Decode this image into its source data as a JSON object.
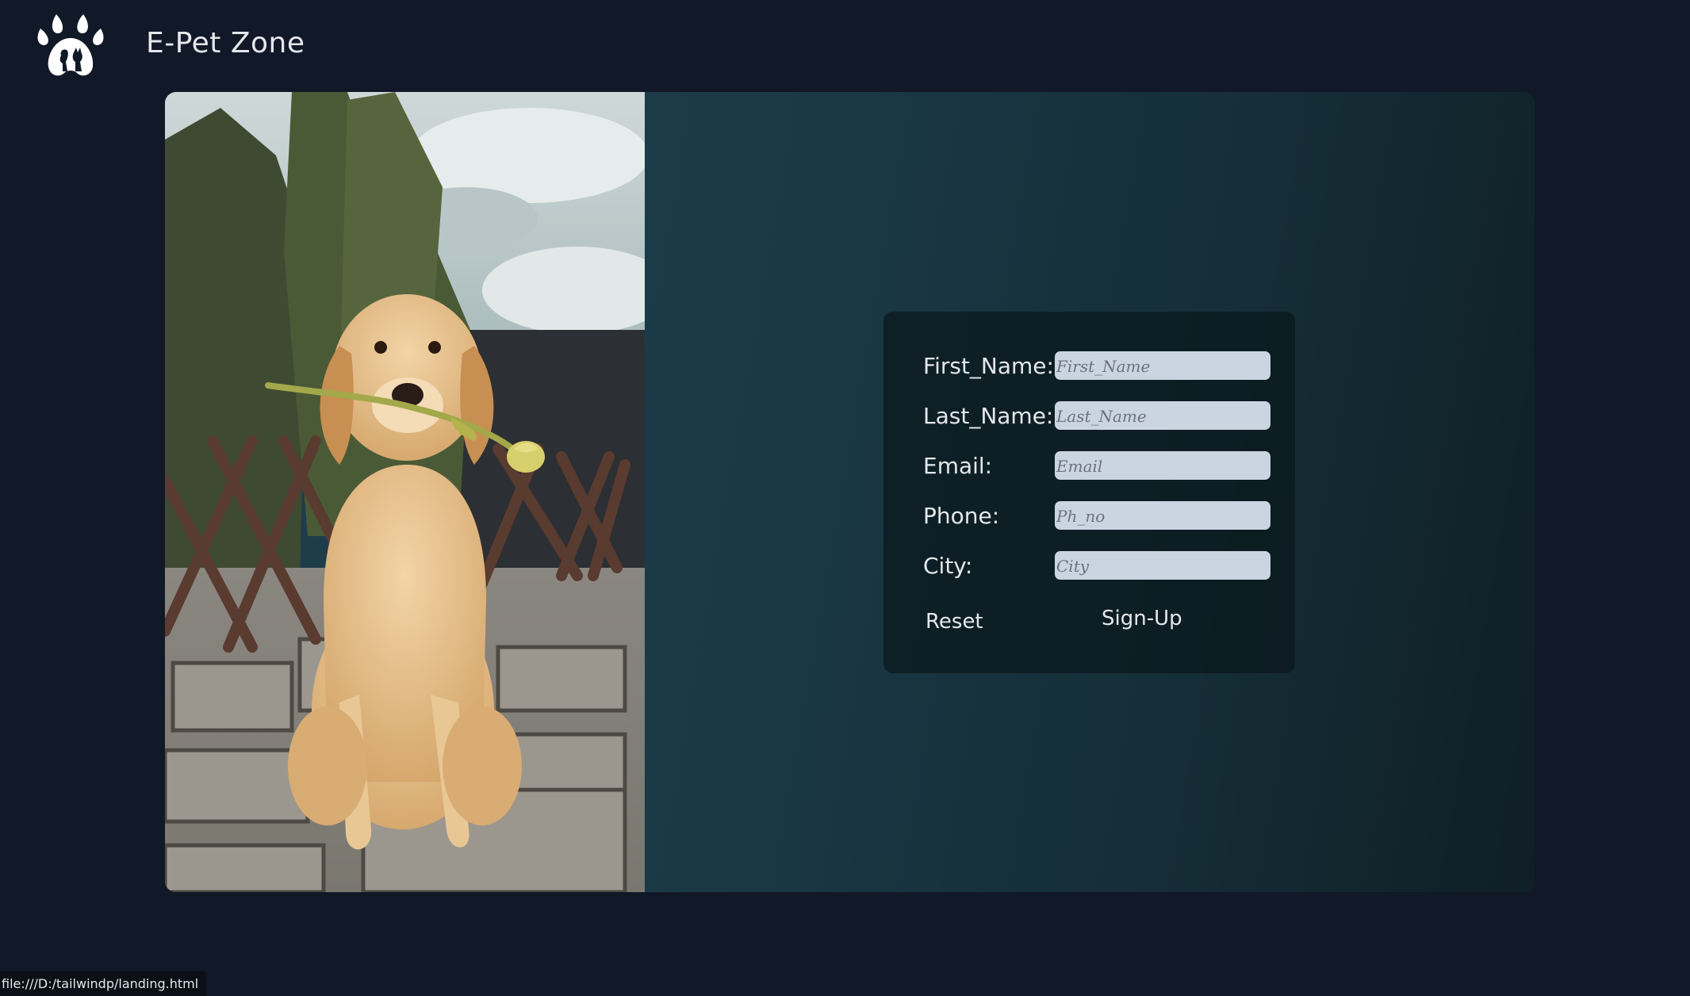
{
  "header": {
    "brand": "E-Pet Zone",
    "logo_icon": "paw-pet-logo-icon"
  },
  "hero": {
    "image": "golden-retriever-puppy-with-tulip-photo"
  },
  "form": {
    "fields": [
      {
        "label": "First_Name:",
        "placeholder": "First_Name",
        "value": ""
      },
      {
        "label": "Last_Name:",
        "placeholder": "Last_Name",
        "value": ""
      },
      {
        "label": "Email:",
        "placeholder": "Email",
        "value": ""
      },
      {
        "label": "Phone:",
        "placeholder": "Ph_no",
        "value": ""
      },
      {
        "label": "City:",
        "placeholder": "City",
        "value": ""
      }
    ],
    "reset_label": "Reset",
    "signup_label": "Sign-Up"
  },
  "status": {
    "url": "file:///D:/tailwindp/landing.html"
  },
  "colors": {
    "page_bg": "#111827",
    "card_gradient_start": "#1e3f4d",
    "card_gradient_end": "#0f1f25",
    "input_bg": "#cbd5e1"
  }
}
